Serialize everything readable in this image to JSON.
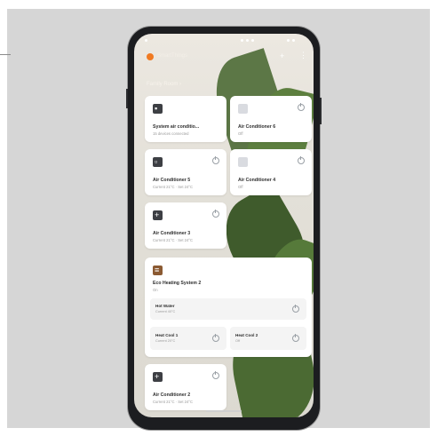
{
  "app": {
    "brand": "SmartThings",
    "location": "Family Room ›",
    "add_icon": "plus-icon",
    "more_icon": "more-icon"
  },
  "devices": [
    {
      "id": "sac",
      "title": "System air conditio...",
      "sub": "15 devices connected",
      "icon": "ac-icon"
    },
    {
      "id": "ac6",
      "title": "Air Conditioner 6",
      "sub": "Off",
      "icon": "ac-icon"
    },
    {
      "id": "ac5",
      "title": "Air Conditioner 5",
      "sub": "Current 21°C · Set 24°C",
      "icon": "ac-icon"
    },
    {
      "id": "ac4",
      "title": "Air Conditioner 4",
      "sub": "Off",
      "icon": "ac-icon"
    },
    {
      "id": "ac3",
      "title": "Air Conditioner 3",
      "sub": "Current 21°C · Set 24°C",
      "icon": "ac-icon"
    },
    {
      "id": "ehs",
      "title": "Eco Heating System 2",
      "sub": "On",
      "icon": "heater-icon"
    },
    {
      "id": "ac2",
      "title": "Air Conditioner 2",
      "sub": "Current 21°C · Set 24°C",
      "icon": "ac-icon"
    }
  ],
  "ehs_sub": [
    {
      "title": "Hot Water",
      "sub": "Current 40°C"
    },
    {
      "title": "Heat Cool 1",
      "sub": "Current 20°C"
    },
    {
      "title": "Heat Cool 2",
      "sub": "Off"
    }
  ],
  "colors": {
    "accent": "#f07a22",
    "card": "#ffffff",
    "background": "#d6d6d6"
  }
}
